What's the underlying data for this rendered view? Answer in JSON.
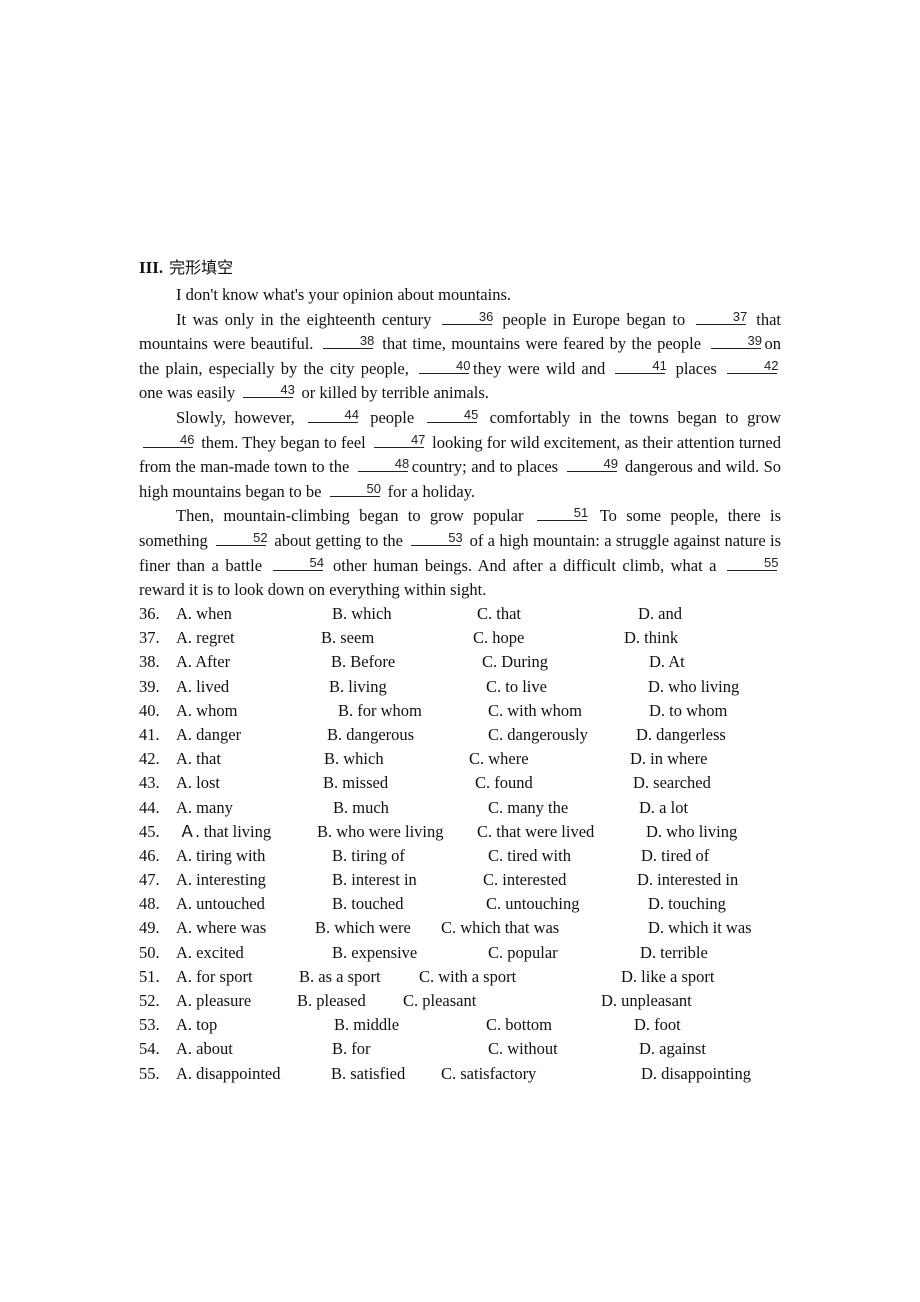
{
  "section": {
    "numeral": "III.",
    "title": "完形填空"
  },
  "passage": {
    "paragraphs": [
      [
        {
          "t": "I don't know what's your opinion about mountains."
        }
      ],
      [
        {
          "t": "It was only in the eighteenth century "
        },
        {
          "b": "36"
        },
        {
          "t": " people in Europe began to "
        },
        {
          "b": "37"
        },
        {
          "t": " that mountains were beautiful. "
        },
        {
          "b": "38"
        },
        {
          "t": " that time, mountains were feared by the people "
        },
        {
          "b": "39"
        },
        {
          "t": "on the plain, especially by the city people, "
        },
        {
          "b": "40"
        },
        {
          "t": "they were wild and "
        },
        {
          "b": "41"
        },
        {
          "t": " places "
        },
        {
          "b": "42"
        },
        {
          "t": " one was easily "
        },
        {
          "b": "43"
        },
        {
          "t": " or killed by terrible animals."
        }
      ],
      [
        {
          "t": "Slowly, however, "
        },
        {
          "b": "44"
        },
        {
          "t": " people "
        },
        {
          "b": "45"
        },
        {
          "t": " comfortably in the towns began to grow "
        },
        {
          "b": "46"
        },
        {
          "t": " them. They began to feel "
        },
        {
          "b": "47"
        },
        {
          "t": " looking for wild excitement, as their attention turned from the man-made town to the "
        },
        {
          "b": "48"
        },
        {
          "t": "country; and to places "
        },
        {
          "b": "49"
        },
        {
          "t": " dangerous and wild. So high mountains began to be "
        },
        {
          "b": "50"
        },
        {
          "t": " for a holiday."
        }
      ],
      [
        {
          "t": "Then, mountain-climbing began to grow popular "
        },
        {
          "b": "51"
        },
        {
          "t": " To some people, there is something "
        },
        {
          "b": "52"
        },
        {
          "t": " about getting to the "
        },
        {
          "b": "53"
        },
        {
          "t": " of a high mountain: a struggle against nature is finer than a battle "
        },
        {
          "b": "54"
        },
        {
          "t": " other human beings. And after a difficult climb, what a "
        },
        {
          "b": "55"
        },
        {
          "t": " reward it is to look down on everything within sight."
        }
      ]
    ]
  },
  "questions": [
    {
      "num": "36.",
      "options": [
        "A. when",
        "B. which",
        "C. that",
        "D. and"
      ]
    },
    {
      "num": "37.",
      "options": [
        "A. regret",
        "B. seem",
        "C. hope",
        "D. think"
      ]
    },
    {
      "num": "38.",
      "options": [
        "A. After",
        "B. Before",
        "C. During",
        "D. At"
      ]
    },
    {
      "num": "39.",
      "options": [
        "A. lived",
        "B. living",
        "C. to live",
        "D. who living"
      ]
    },
    {
      "num": "40.",
      "options": [
        "A. whom",
        "B. for whom",
        "C. with whom",
        "D. to whom"
      ]
    },
    {
      "num": "41.",
      "options": [
        "A. danger",
        "B. dangerous",
        "C. dangerously",
        "D. dangerless"
      ]
    },
    {
      "num": "42.",
      "options": [
        "A. that",
        "B. which",
        "C. where",
        "D. in where"
      ]
    },
    {
      "num": "43.",
      "options": [
        "A. lost",
        "B. missed",
        "C. found",
        "D. searched"
      ]
    },
    {
      "num": "44.",
      "options": [
        "A. many",
        "B. much",
        "C. many the",
        "D. a lot"
      ]
    },
    {
      "num": "45.",
      "options": [
        "Ａ. that living",
        "B. who were living",
        "C. that were lived",
        "D. who living"
      ]
    },
    {
      "num": "46.",
      "options": [
        "A. tiring with",
        "B. tiring of",
        "C. tired with",
        "D. tired of"
      ]
    },
    {
      "num": "47.",
      "options": [
        "A. interesting",
        "B. interest in",
        "C. interested",
        "D. interested in"
      ]
    },
    {
      "num": "48.",
      "options": [
        "A. untouched",
        "B. touched",
        "C. untouching",
        "D. touching"
      ]
    },
    {
      "num": "49.",
      "options": [
        "A. where was",
        "B. which were",
        "C. which that was",
        "D. which it was"
      ]
    },
    {
      "num": "50.",
      "options": [
        "A. excited",
        "B. expensive",
        "C. popular",
        "D. terrible"
      ]
    },
    {
      "num": "51.",
      "options": [
        "A. for sport",
        "B. as a sport",
        "C. with a sport",
        "D. like a sport"
      ]
    },
    {
      "num": "52.",
      "options": [
        "A. pleasure",
        "B. pleased",
        "C. pleasant",
        "D. unpleasant"
      ]
    },
    {
      "num": "53.",
      "options": [
        "A. top",
        "B. middle",
        "C. bottom",
        "D. foot"
      ]
    },
    {
      "num": "54.",
      "options": [
        "A. about",
        "B. for",
        "C. without",
        "D. against"
      ]
    },
    {
      "num": "55.",
      "options": [
        "A. disappointed",
        "B. satisfied",
        "C. satisfactory",
        "D. disappointing"
      ]
    }
  ]
}
